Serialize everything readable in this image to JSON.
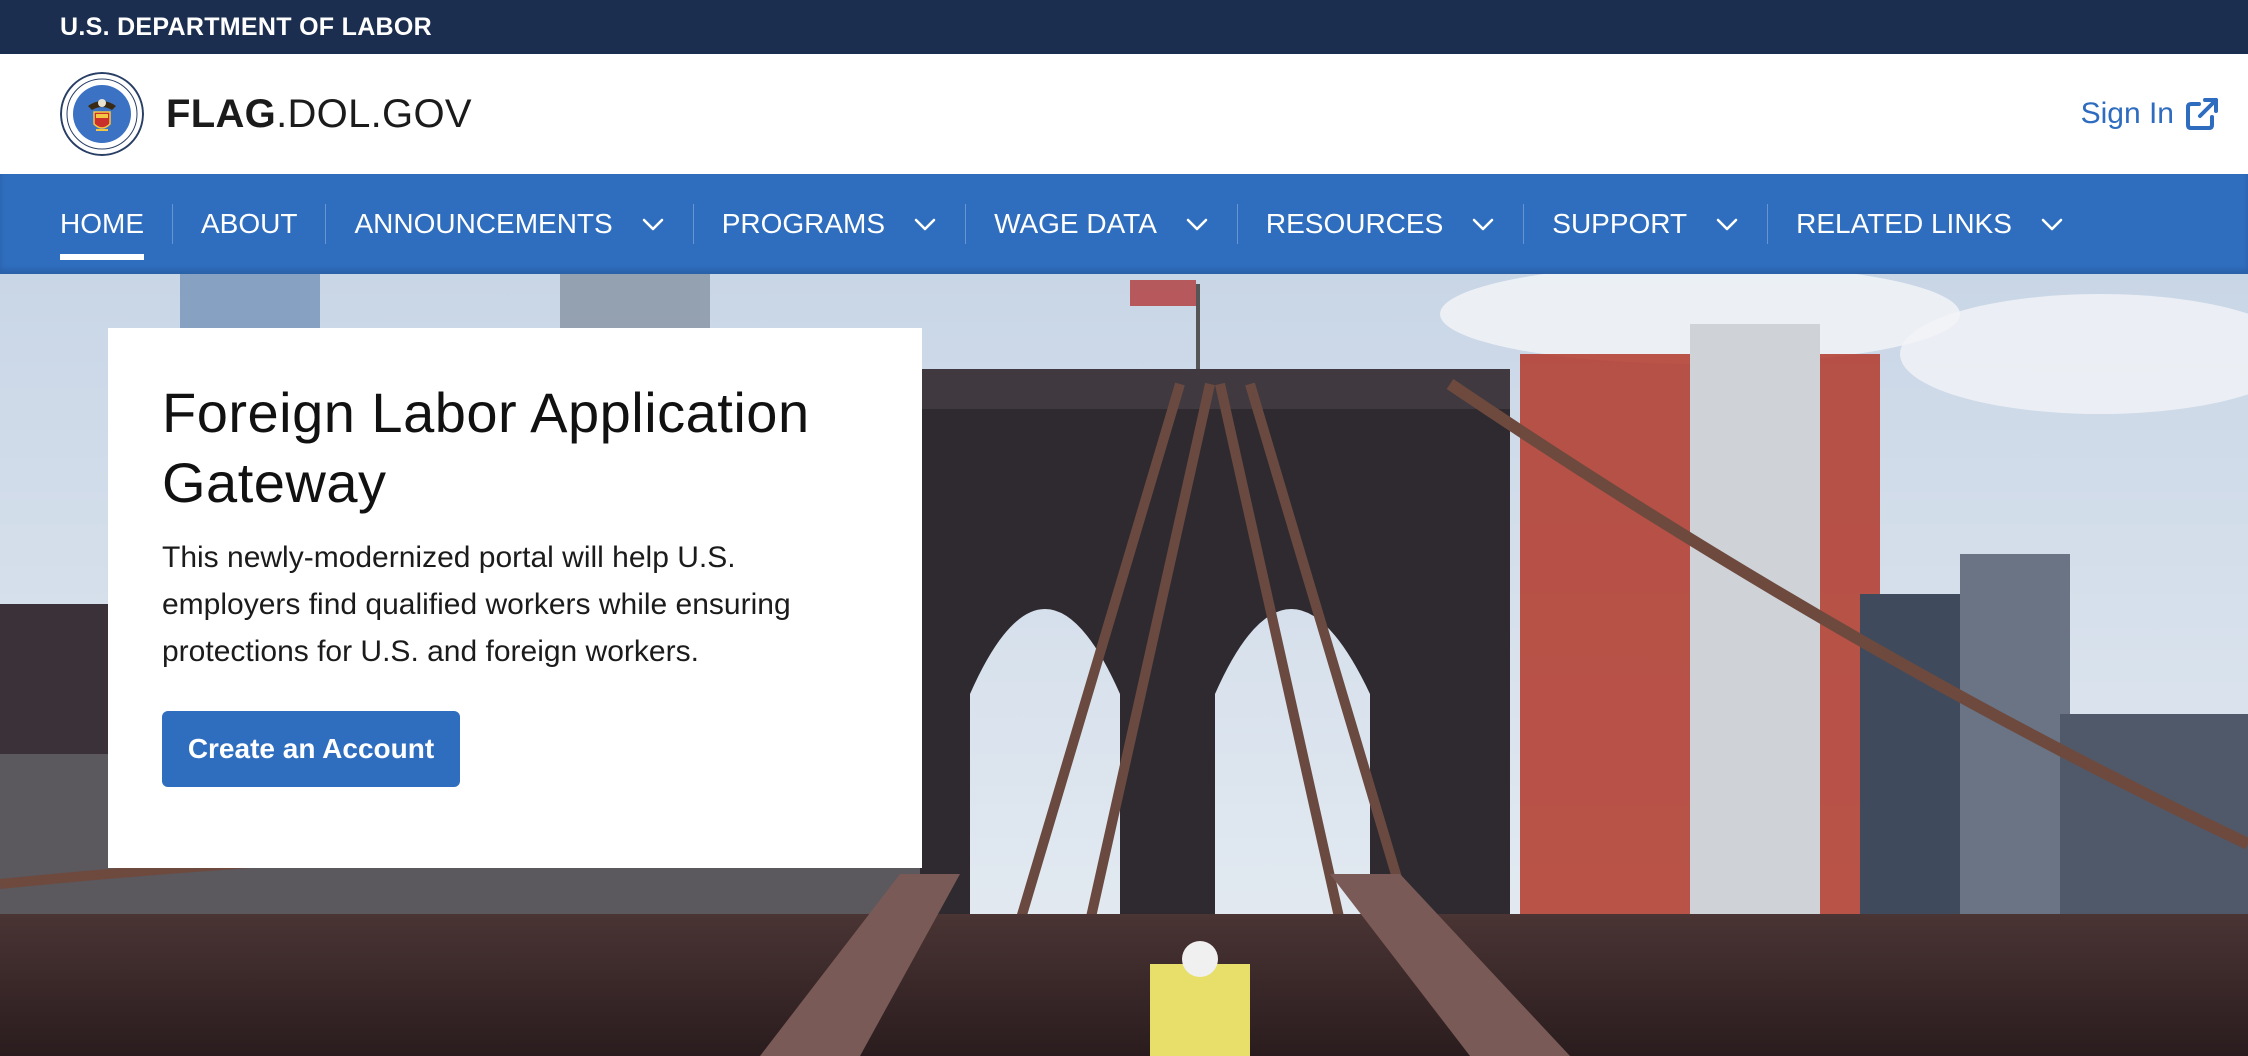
{
  "banner": {
    "agency": "U.S. DEPARTMENT OF LABOR"
  },
  "header": {
    "site_title_bold": "FLAG",
    "site_title_rest": ".DOL.GOV",
    "sign_in_label": "Sign In",
    "seal_icon": "dol-seal-icon"
  },
  "nav": {
    "items": [
      {
        "label": "HOME",
        "active": true,
        "dropdown": false
      },
      {
        "label": "ABOUT",
        "active": false,
        "dropdown": false
      },
      {
        "label": "ANNOUNCEMENTS",
        "active": false,
        "dropdown": true
      },
      {
        "label": "PROGRAMS",
        "active": false,
        "dropdown": true
      },
      {
        "label": "WAGE DATA",
        "active": false,
        "dropdown": true
      },
      {
        "label": "RESOURCES",
        "active": false,
        "dropdown": true
      },
      {
        "label": "SUPPORT",
        "active": false,
        "dropdown": true
      },
      {
        "label": "RELATED LINKS",
        "active": false,
        "dropdown": true
      }
    ]
  },
  "hero": {
    "title": "Foreign Labor Application Gateway",
    "description": "This newly-modernized portal will help U.S. employers find qualified workers while ensuring protections for U.S. and foreign workers.",
    "cta_label": "Create an Account",
    "background": "brooklyn-bridge-photo"
  },
  "colors": {
    "banner": "#1b2e4f",
    "nav": "#2f6dbe",
    "accent": "#2e6cbf",
    "text": "#1b1b1b"
  }
}
